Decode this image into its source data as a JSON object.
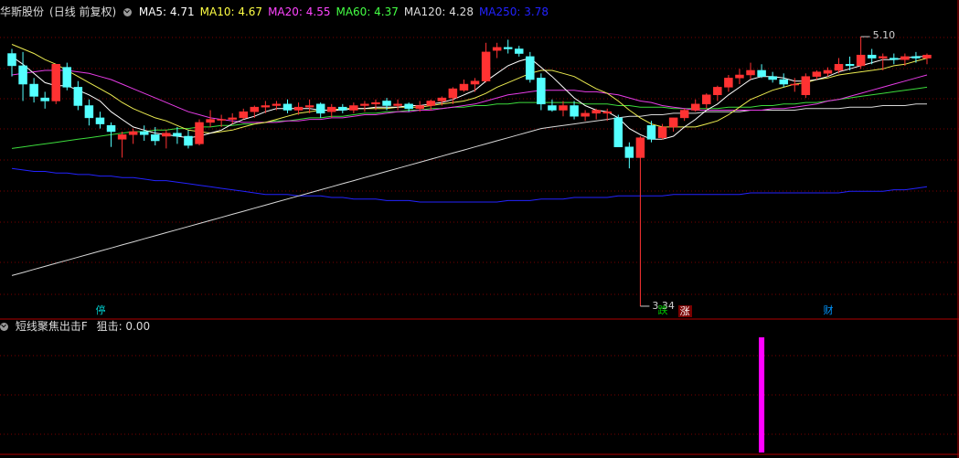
{
  "main": {
    "stock_name": "华斯股份",
    "period": "(日线 前复权)",
    "ma": [
      {
        "label": "MA5: 4.71",
        "color": "#ffffff"
      },
      {
        "label": "MA10: 4.67",
        "color": "#ffff44"
      },
      {
        "label": "MA20: 4.55",
        "color": "#ff44ff"
      },
      {
        "label": "MA60: 4.37",
        "color": "#44ff44"
      },
      {
        "label": "MA120: 4.28",
        "color": "#dddddd"
      },
      {
        "label": "MA250: 3.78",
        "color": "#2222ff"
      }
    ],
    "high_label": "5.10",
    "low_label": "3.34",
    "tags": [
      {
        "text": "停",
        "color": "#00c8c8"
      },
      {
        "text": "跌",
        "color": "#00c800"
      },
      {
        "text": "涨",
        "color": "#ff3030"
      },
      {
        "text": "财",
        "color": "#0096ff"
      }
    ]
  },
  "sub": {
    "title": "短线聚焦出击F",
    "value_label": "狙击: 0.00",
    "bar_color": "#ff00ff"
  },
  "colors": {
    "up": "#ff3232",
    "down": "#54ffff",
    "grid": "#7a0000"
  },
  "chart_data": {
    "type": "candlestick",
    "ohlc": [
      [
        4.99,
        5.02,
        4.84,
        4.91
      ],
      [
        4.91,
        5.0,
        4.68,
        4.79
      ],
      [
        4.79,
        4.83,
        4.67,
        4.71
      ],
      [
        4.7,
        4.74,
        4.63,
        4.68
      ],
      [
        4.68,
        4.92,
        4.66,
        4.92
      ],
      [
        4.9,
        4.93,
        4.75,
        4.77
      ],
      [
        4.77,
        4.81,
        4.62,
        4.65
      ],
      [
        4.65,
        4.69,
        4.52,
        4.57
      ],
      [
        4.57,
        4.61,
        4.5,
        4.53
      ],
      [
        4.52,
        4.54,
        4.38,
        4.48
      ],
      [
        4.43,
        4.48,
        4.31,
        4.46
      ],
      [
        4.46,
        4.5,
        4.4,
        4.48
      ],
      [
        4.48,
        4.52,
        4.42,
        4.46
      ],
      [
        4.46,
        4.51,
        4.39,
        4.42
      ],
      [
        4.45,
        4.49,
        4.37,
        4.47
      ],
      [
        4.47,
        4.51,
        4.4,
        4.45
      ],
      [
        4.45,
        4.49,
        4.37,
        4.39
      ],
      [
        4.4,
        4.56,
        4.39,
        4.54
      ],
      [
        4.54,
        4.62,
        4.51,
        4.56
      ],
      [
        4.56,
        4.59,
        4.51,
        4.56
      ],
      [
        4.56,
        4.6,
        4.53,
        4.57
      ],
      [
        4.57,
        4.63,
        4.56,
        4.61
      ],
      [
        4.61,
        4.65,
        4.57,
        4.64
      ],
      [
        4.64,
        4.68,
        4.6,
        4.65
      ],
      [
        4.65,
        4.68,
        4.62,
        4.66
      ],
      [
        4.66,
        4.69,
        4.6,
        4.62
      ],
      [
        4.62,
        4.67,
        4.59,
        4.64
      ],
      [
        4.64,
        4.69,
        4.6,
        4.65
      ],
      [
        4.66,
        4.67,
        4.57,
        4.6
      ],
      [
        4.61,
        4.66,
        4.57,
        4.64
      ],
      [
        4.64,
        4.66,
        4.6,
        4.62
      ],
      [
        4.62,
        4.67,
        4.6,
        4.65
      ],
      [
        4.65,
        4.68,
        4.61,
        4.66
      ],
      [
        4.66,
        4.69,
        4.62,
        4.67
      ],
      [
        4.68,
        4.7,
        4.62,
        4.65
      ],
      [
        4.65,
        4.69,
        4.62,
        4.66
      ],
      [
        4.66,
        4.67,
        4.61,
        4.63
      ],
      [
        4.63,
        4.68,
        4.61,
        4.65
      ],
      [
        4.65,
        4.69,
        4.62,
        4.68
      ],
      [
        4.68,
        4.71,
        4.65,
        4.7
      ],
      [
        4.7,
        4.77,
        4.66,
        4.76
      ],
      [
        4.75,
        4.82,
        4.74,
        4.79
      ],
      [
        4.79,
        4.83,
        4.74,
        4.81
      ],
      [
        4.81,
        5.06,
        4.8,
        5.0
      ],
      [
        5.01,
        5.06,
        4.96,
        5.03
      ],
      [
        5.03,
        5.08,
        4.99,
        5.02
      ],
      [
        5.02,
        5.04,
        4.97,
        4.99
      ],
      [
        4.97,
        5.0,
        4.8,
        4.82
      ],
      [
        4.83,
        4.86,
        4.62,
        4.66
      ],
      [
        4.65,
        4.69,
        4.61,
        4.62
      ],
      [
        4.62,
        4.68,
        4.58,
        4.65
      ],
      [
        4.65,
        4.68,
        4.56,
        4.58
      ],
      [
        4.58,
        4.62,
        4.55,
        4.6
      ],
      [
        4.6,
        4.63,
        4.56,
        4.62
      ],
      [
        4.6,
        4.63,
        4.55,
        4.61
      ],
      [
        4.57,
        4.59,
        4.38,
        4.38
      ],
      [
        4.38,
        4.41,
        4.24,
        4.31
      ],
      [
        4.31,
        4.45,
        3.34,
        4.44
      ],
      [
        4.52,
        4.55,
        4.41,
        4.43
      ],
      [
        4.44,
        4.53,
        4.43,
        4.51
      ],
      [
        4.51,
        4.57,
        4.48,
        4.57
      ],
      [
        4.57,
        4.63,
        4.55,
        4.62
      ],
      [
        4.62,
        4.69,
        4.61,
        4.66
      ],
      [
        4.66,
        4.73,
        4.63,
        4.72
      ],
      [
        4.72,
        4.78,
        4.68,
        4.77
      ],
      [
        4.77,
        4.85,
        4.74,
        4.83
      ],
      [
        4.83,
        4.89,
        4.79,
        4.85
      ],
      [
        4.85,
        4.93,
        4.82,
        4.88
      ],
      [
        4.88,
        4.92,
        4.83,
        4.84
      ],
      [
        4.84,
        4.87,
        4.8,
        4.82
      ],
      [
        4.82,
        4.86,
        4.77,
        4.79
      ],
      [
        4.79,
        4.83,
        4.74,
        4.79
      ],
      [
        4.72,
        4.86,
        4.7,
        4.84
      ],
      [
        4.84,
        4.88,
        4.82,
        4.87
      ],
      [
        4.86,
        4.9,
        4.84,
        4.88
      ],
      [
        4.88,
        4.96,
        4.86,
        4.92
      ],
      [
        4.92,
        4.97,
        4.88,
        4.91
      ],
      [
        4.91,
        5.1,
        4.89,
        4.98
      ],
      [
        4.98,
        5.02,
        4.92,
        4.96
      ],
      [
        4.96,
        4.99,
        4.88,
        4.97
      ],
      [
        4.96,
        4.99,
        4.92,
        4.95
      ],
      [
        4.95,
        4.99,
        4.91,
        4.97
      ],
      [
        4.97,
        5.0,
        4.93,
        4.96
      ],
      [
        4.96,
        4.99,
        4.92,
        4.98
      ]
    ],
    "ma5": [
      4.97,
      4.92,
      4.86,
      4.8,
      4.78,
      4.78,
      4.75,
      4.72,
      4.68,
      4.61,
      4.56,
      4.51,
      4.49,
      4.47,
      4.46,
      4.45,
      4.44,
      4.45,
      4.47,
      4.49,
      4.53,
      4.56,
      4.58,
      4.61,
      4.63,
      4.63,
      4.63,
      4.63,
      4.62,
      4.62,
      4.62,
      4.63,
      4.63,
      4.64,
      4.64,
      4.64,
      4.65,
      4.65,
      4.66,
      4.67,
      4.69,
      4.72,
      4.75,
      4.81,
      4.86,
      4.91,
      4.94,
      4.96,
      4.9,
      4.84,
      4.77,
      4.7,
      4.65,
      4.62,
      4.61,
      4.57,
      4.5,
      4.46,
      4.43,
      4.43,
      4.45,
      4.51,
      4.56,
      4.62,
      4.66,
      4.72,
      4.77,
      4.82,
      4.84,
      4.84,
      4.83,
      4.81,
      4.81,
      4.82,
      4.84,
      4.87,
      4.89,
      4.91,
      4.93,
      4.95,
      4.95,
      4.96,
      4.97,
      4.97
    ],
    "ma10": [
      5.05,
      5.02,
      4.99,
      4.95,
      4.92,
      4.88,
      4.84,
      4.8,
      4.76,
      4.72,
      4.67,
      4.63,
      4.6,
      4.57,
      4.55,
      4.52,
      4.49,
      4.48,
      4.47,
      4.48,
      4.49,
      4.51,
      4.53,
      4.54,
      4.56,
      4.58,
      4.6,
      4.61,
      4.62,
      4.62,
      4.63,
      4.63,
      4.63,
      4.63,
      4.63,
      4.64,
      4.64,
      4.64,
      4.65,
      4.66,
      4.67,
      4.68,
      4.7,
      4.73,
      4.77,
      4.8,
      4.83,
      4.86,
      4.88,
      4.88,
      4.86,
      4.84,
      4.8,
      4.76,
      4.73,
      4.68,
      4.62,
      4.57,
      4.53,
      4.51,
      4.51,
      4.51,
      4.51,
      4.53,
      4.55,
      4.59,
      4.64,
      4.69,
      4.72,
      4.75,
      4.77,
      4.79,
      4.8,
      4.82,
      4.83,
      4.85,
      4.86,
      4.87,
      4.88,
      4.89,
      4.91,
      4.92,
      4.94,
      4.96
    ],
    "ma20": [
      4.85,
      4.86,
      4.87,
      4.88,
      4.88,
      4.88,
      4.87,
      4.86,
      4.84,
      4.82,
      4.79,
      4.76,
      4.73,
      4.7,
      4.67,
      4.64,
      4.61,
      4.59,
      4.57,
      4.56,
      4.55,
      4.54,
      4.54,
      4.54,
      4.54,
      4.55,
      4.55,
      4.56,
      4.56,
      4.57,
      4.57,
      4.58,
      4.59,
      4.59,
      4.6,
      4.61,
      4.61,
      4.62,
      4.62,
      4.63,
      4.64,
      4.65,
      4.66,
      4.68,
      4.7,
      4.72,
      4.73,
      4.74,
      4.75,
      4.75,
      4.75,
      4.75,
      4.74,
      4.74,
      4.73,
      4.72,
      4.7,
      4.68,
      4.67,
      4.65,
      4.64,
      4.63,
      4.62,
      4.62,
      4.62,
      4.62,
      4.62,
      4.62,
      4.62,
      4.63,
      4.63,
      4.64,
      4.65,
      4.66,
      4.68,
      4.69,
      4.71,
      4.73,
      4.75,
      4.77,
      4.79,
      4.81,
      4.83,
      4.85
    ],
    "ma60": [
      4.37,
      4.38,
      4.39,
      4.4,
      4.41,
      4.42,
      4.43,
      4.44,
      4.45,
      4.46,
      4.47,
      4.48,
      4.48,
      4.49,
      4.49,
      4.5,
      4.5,
      4.51,
      4.51,
      4.52,
      4.52,
      4.53,
      4.53,
      4.54,
      4.55,
      4.55,
      4.56,
      4.57,
      4.57,
      4.58,
      4.58,
      4.59,
      4.6,
      4.6,
      4.61,
      4.61,
      4.62,
      4.62,
      4.63,
      4.63,
      4.64,
      4.64,
      4.65,
      4.65,
      4.66,
      4.66,
      4.67,
      4.67,
      4.67,
      4.67,
      4.67,
      4.67,
      4.66,
      4.66,
      4.66,
      4.65,
      4.65,
      4.64,
      4.64,
      4.64,
      4.63,
      4.63,
      4.63,
      4.63,
      4.63,
      4.64,
      4.64,
      4.64,
      4.65,
      4.65,
      4.66,
      4.66,
      4.67,
      4.67,
      4.68,
      4.69,
      4.7,
      4.71,
      4.72,
      4.73,
      4.74,
      4.75,
      4.76,
      4.77
    ],
    "ma120": [
      3.54,
      3.56,
      3.58,
      3.6,
      3.62,
      3.64,
      3.66,
      3.68,
      3.7,
      3.72,
      3.74,
      3.76,
      3.78,
      3.8,
      3.82,
      3.84,
      3.86,
      3.88,
      3.9,
      3.92,
      3.94,
      3.96,
      3.98,
      4.0,
      4.02,
      4.04,
      4.06,
      4.08,
      4.1,
      4.12,
      4.14,
      4.16,
      4.18,
      4.2,
      4.22,
      4.24,
      4.26,
      4.28,
      4.3,
      4.32,
      4.34,
      4.36,
      4.38,
      4.4,
      4.42,
      4.44,
      4.46,
      4.48,
      4.5,
      4.51,
      4.52,
      4.53,
      4.54,
      4.55,
      4.56,
      4.57,
      4.58,
      4.58,
      4.59,
      4.59,
      4.6,
      4.6,
      4.6,
      4.61,
      4.61,
      4.61,
      4.61,
      4.62,
      4.62,
      4.62,
      4.62,
      4.62,
      4.63,
      4.63,
      4.63,
      4.63,
      4.64,
      4.64,
      4.64,
      4.65,
      4.65,
      4.65,
      4.66,
      4.66
    ],
    "ma250": [
      4.24,
      4.23,
      4.22,
      4.22,
      4.21,
      4.21,
      4.2,
      4.2,
      4.19,
      4.19,
      4.18,
      4.18,
      4.17,
      4.16,
      4.16,
      4.15,
      4.14,
      4.13,
      4.12,
      4.11,
      4.1,
      4.09,
      4.08,
      4.07,
      4.07,
      4.07,
      4.06,
      4.06,
      4.06,
      4.05,
      4.05,
      4.04,
      4.04,
      4.04,
      4.03,
      4.03,
      4.03,
      4.02,
      4.02,
      4.02,
      4.02,
      4.02,
      4.02,
      4.02,
      4.02,
      4.03,
      4.03,
      4.03,
      4.04,
      4.04,
      4.04,
      4.05,
      4.05,
      4.05,
      4.05,
      4.06,
      4.06,
      4.06,
      4.06,
      4.06,
      4.07,
      4.07,
      4.07,
      4.07,
      4.07,
      4.07,
      4.07,
      4.08,
      4.08,
      4.08,
      4.08,
      4.08,
      4.08,
      4.08,
      4.08,
      4.08,
      4.09,
      4.09,
      4.09,
      4.09,
      4.1,
      4.1,
      4.11,
      4.12
    ],
    "sub_bar": {
      "index": 68,
      "value": 1
    },
    "tag_positions": [
      8,
      59,
      61,
      74
    ]
  }
}
